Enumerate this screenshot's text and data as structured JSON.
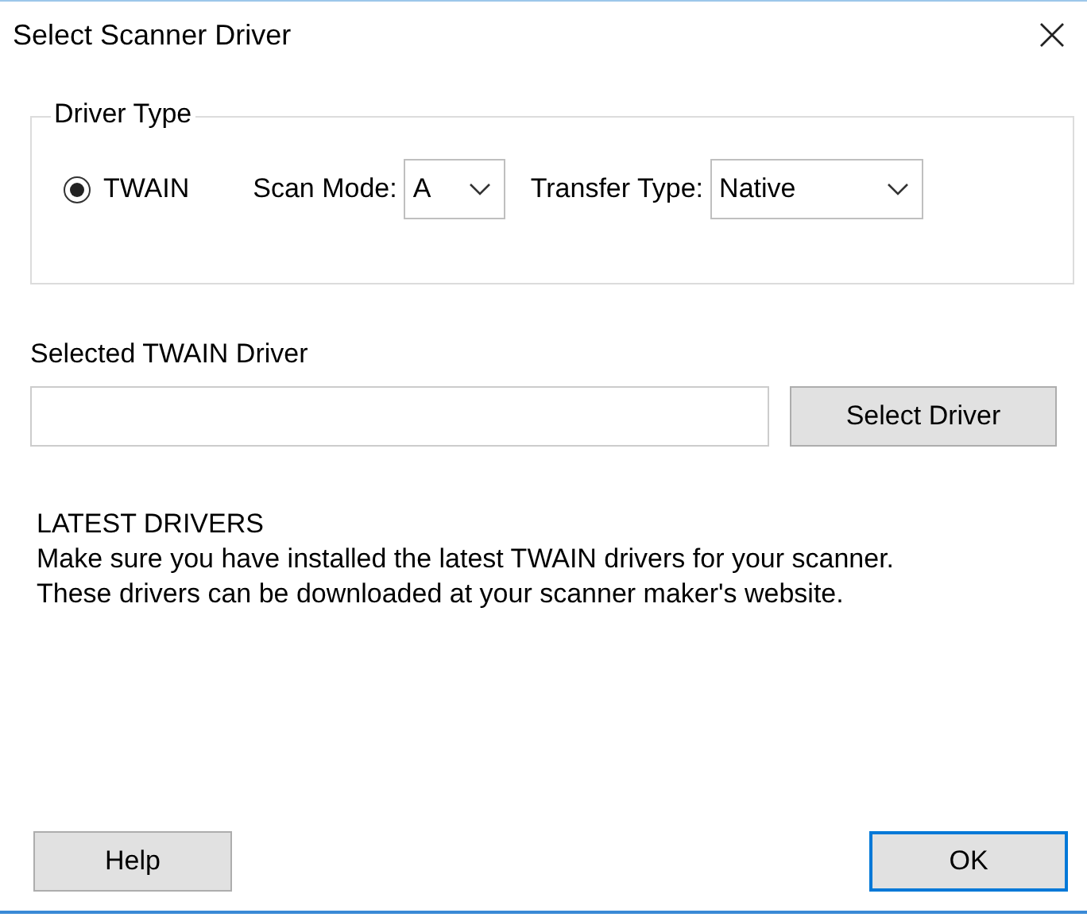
{
  "window": {
    "title": "Select Scanner Driver"
  },
  "driver_type": {
    "title": "Driver Type",
    "options": [
      {
        "label": "TWAIN",
        "selected": true
      }
    ],
    "scan_mode": {
      "label": "Scan Mode:",
      "value": "A"
    },
    "transfer_type": {
      "label": "Transfer Type:",
      "value": "Native"
    }
  },
  "selected_driver": {
    "label": "Selected TWAIN Driver",
    "button": "Select Driver"
  },
  "info": {
    "heading": "LATEST DRIVERS",
    "lines": [
      "Make sure you have installed the latest TWAIN drivers for your scanner.",
      "These drivers can be downloaded at your scanner maker's website."
    ]
  },
  "buttons": [
    {
      "label": "Help",
      "default": false
    },
    {
      "label": "OK",
      "default": true
    }
  ]
}
